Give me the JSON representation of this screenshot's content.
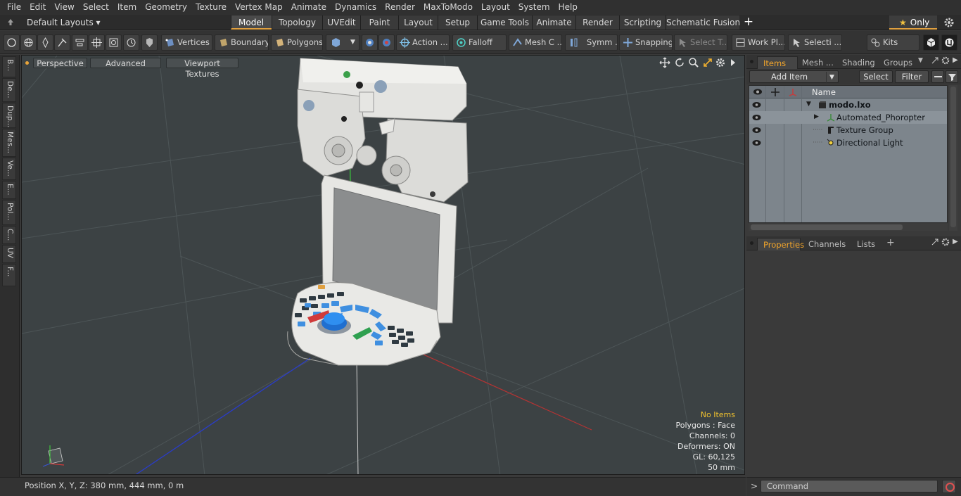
{
  "menu": [
    "File",
    "Edit",
    "View",
    "Select",
    "Item",
    "Geometry",
    "Texture",
    "Vertex Map",
    "Animate",
    "Dynamics",
    "Render",
    "MaxToModo",
    "Layout",
    "System",
    "Help"
  ],
  "layouts": {
    "label": "Default Layouts ▾"
  },
  "tabs": [
    "Model",
    "Topology",
    "UVEdit",
    "Paint",
    "Layout",
    "Setup",
    "Game Tools",
    "Animate",
    "Render",
    "Scripting",
    "Schematic Fusion"
  ],
  "active_tab": "Model",
  "only_label": "Only",
  "toolbar": {
    "vertices": "Vertices",
    "boundary": "Boundary",
    "polygons": "Polygons",
    "action": "Action ...",
    "falloff": "Falloff",
    "mesh": "Mesh C ...",
    "symm": "Symm ...",
    "snapping": "Snapping",
    "select_t": "Select T...",
    "work_pl": "Work Pl...",
    "selecti": "Selecti ...",
    "kits": "Kits"
  },
  "left_tabs": [
    "B...",
    "De...",
    "Dup...",
    "Mes...",
    "Ve...",
    "E...",
    "Pol...",
    "C...",
    "UV",
    "F..."
  ],
  "viewport": {
    "perspective": "Perspective",
    "advanced": "Advanced",
    "textures": "Viewport Textures",
    "info": {
      "items": "No Items",
      "polygons": "Polygons : Face",
      "channels": "Channels: 0",
      "deformers": "Deformers: ON",
      "gl": "GL: 60,125",
      "scale": "50 mm"
    }
  },
  "items_panel": {
    "tabs": [
      "Items",
      "Mesh ...",
      "Shading",
      "Groups"
    ],
    "add_item": "Add Item",
    "select": "Select",
    "filter": "Filter",
    "name_col": "Name",
    "tree": [
      {
        "label": "modo.lxo",
        "icon": "scene-icon"
      },
      {
        "label": "Automated_Phoropter",
        "icon": "mesh-locator-icon"
      },
      {
        "label": "Texture Group",
        "icon": "texture-group-icon"
      },
      {
        "label": "Directional Light",
        "icon": "light-icon"
      }
    ]
  },
  "props_panel": {
    "tabs": [
      "Properties",
      "Channels",
      "Lists"
    ]
  },
  "status": {
    "position": "Position X, Y, Z:  380 mm, 444 mm, 0 m"
  },
  "command": {
    "placeholder": "Command"
  },
  "colors": {
    "accent": "#f2a52b",
    "info_highlight": "#f2c32e",
    "viewport_bg": "#3c4244",
    "tree_bg": "#7d858c"
  }
}
